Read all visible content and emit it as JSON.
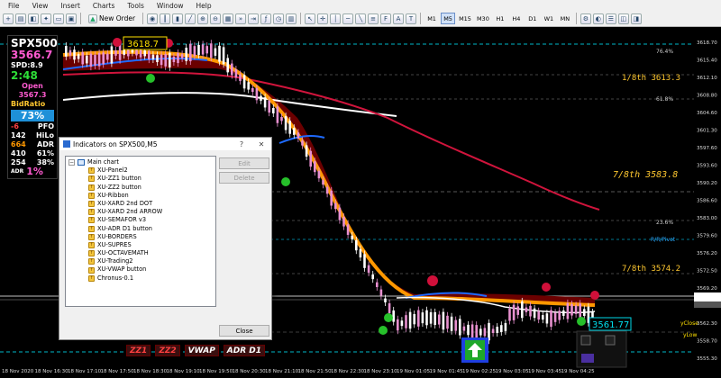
{
  "menu": [
    "File",
    "View",
    "Insert",
    "Charts",
    "Tools",
    "Window",
    "Help"
  ],
  "toolbar": {
    "new_order": "New Order",
    "timeframes": [
      "M1",
      "M5",
      "M15",
      "M30",
      "H1",
      "H4",
      "D1",
      "W1",
      "MN"
    ],
    "active_timeframe": "M5"
  },
  "dashboard": {
    "symbol": "SPX500",
    "price": "3566.7",
    "spread": "SPD:8.9",
    "timer": "2:48",
    "open_label": "Open",
    "open_value": "3567.3",
    "bidratio_label": "BidRatio",
    "bidratio_value": "73%",
    "rows": [
      {
        "a": "-6",
        "b": "PFO"
      },
      {
        "a": "142",
        "b": "HiLo"
      },
      {
        "a": "664",
        "b": "ADR"
      },
      {
        "a": "410",
        "b": "61%"
      },
      {
        "a": "254",
        "b": "38%"
      }
    ],
    "adr_label": "ADR",
    "adr_pct": "1%"
  },
  "chart_labels": {
    "high_marker": "3618.7",
    "current_marker": "3561.77",
    "one_eighth": "1/8th  3613.3",
    "seven_eighth_a": "7/8th  3583.8",
    "seven_eighth_b": "7/8th  3574.2",
    "fib_764": "76.4%",
    "fib_618": "61.8%",
    "fib_236": "23.6%",
    "rr_pivot": "R/R/Pivot",
    "yclose": "yClose",
    "ylow": "yLow"
  },
  "price_axis": [
    "3618.70",
    "3615.40",
    "3612.10",
    "3608.80",
    "3604.60",
    "3601.30",
    "3597.60",
    "3593.60",
    "3590.20",
    "3586.60",
    "3583.00",
    "3579.60",
    "3576.20",
    "3572.50",
    "3569.20",
    "3565.70",
    "3562.30",
    "3558.70",
    "3555.30"
  ],
  "time_axis": [
    "18 Nov 2020",
    "18 Nov 16:30",
    "18 Nov 17:10",
    "18 Nov 17:50",
    "18 Nov 18:30",
    "18 Nov 19:10",
    "18 Nov 19:50",
    "18 Nov 20:30",
    "18 Nov 21:10",
    "18 Nov 21:50",
    "18 Nov 22:30",
    "18 Nov 23:10",
    "19 Nov 01:05",
    "19 Nov 01:45",
    "19 Nov 02:25",
    "19 Nov 03:05",
    "19 Nov 03:45",
    "19 Nov 04:25"
  ],
  "dialog": {
    "title": "Indicators on SPX500,M5",
    "help": "?",
    "close_x": "✕",
    "root": "Main chart",
    "items": [
      "XU-Panel2",
      "XU-ZZ1 button",
      "XU-ZZ2 button",
      "XU-Ribbon",
      "XU-XARD 2nd DOT",
      "XU-XARD 2nd ARROW",
      "XU-SEMAFOR v3",
      "XU-ADR D1 button",
      "XU-BORDERS",
      "XU-SUPRES",
      "XU-OCTAVEMATH",
      "XU-Trading2",
      "XU-VWAP button",
      "Chronus-0.1"
    ],
    "edit": "Edit",
    "delete": "Delete",
    "close": "Close"
  },
  "bottom_buttons": [
    "ZZ1",
    "ZZ2",
    "VWAP",
    "ADR D1"
  ],
  "colors": {
    "bg": "#000000",
    "ribbon_fill": "#6b0000",
    "orange": "#ff9800",
    "red_ma": "#d0143c",
    "white_ma": "#ffffff"
  }
}
